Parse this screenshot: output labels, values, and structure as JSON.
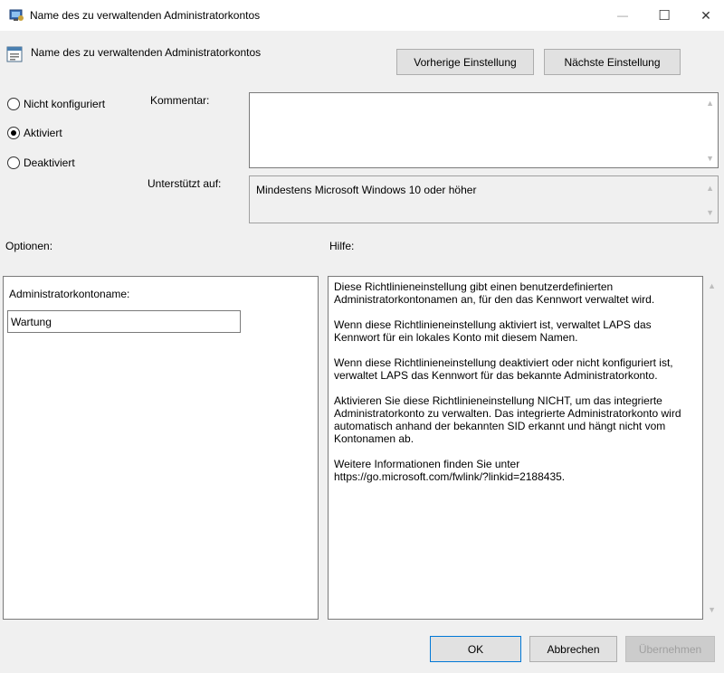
{
  "window": {
    "title": "Name des zu verwaltenden Administratorkontos",
    "minimize_glyph": "—",
    "maximize_glyph": "☐",
    "close_glyph": "✕"
  },
  "header": {
    "policy_name": "Name des zu verwaltenden Administratorkontos",
    "prev_button": "Vorherige Einstellung",
    "next_button": "Nächste Einstellung"
  },
  "state": {
    "options": [
      {
        "label": "Nicht konfiguriert",
        "selected": false
      },
      {
        "label": "Aktiviert",
        "selected": true
      },
      {
        "label": "Deaktiviert",
        "selected": false
      }
    ]
  },
  "comment": {
    "label": "Kommentar:",
    "value": ""
  },
  "supported": {
    "label": "Unterstützt auf:",
    "value": "Mindestens Microsoft Windows 10 oder höher"
  },
  "options_section": {
    "label": "Optionen:",
    "field_label": "Administratorkontoname:",
    "field_value": "Wartung"
  },
  "help_section": {
    "label": "Hilfe:",
    "paragraphs": [
      "Diese Richtlinieneinstellung gibt einen benutzerdefinierten Administratorkontonamen an, für den das Kennwort verwaltet wird.",
      "Wenn diese Richtlinieneinstellung aktiviert ist, verwaltet LAPS das Kennwort für ein lokales Konto mit diesem Namen.",
      "Wenn diese Richtlinieneinstellung deaktiviert oder nicht konfiguriert ist, verwaltet LAPS das Kennwort für das bekannte Administratorkonto.",
      "Aktivieren Sie diese Richtlinieneinstellung NICHT, um das integrierte Administratorkonto zu verwalten. Das integrierte Administratorkonto wird automatisch anhand der bekannten SID erkannt und hängt nicht vom Kontonamen ab.",
      "Weitere Informationen finden Sie unter https://go.microsoft.com/fwlink/?linkid=2188435."
    ]
  },
  "footer": {
    "ok": "OK",
    "cancel": "Abbrechen",
    "apply": "Übernehmen"
  }
}
